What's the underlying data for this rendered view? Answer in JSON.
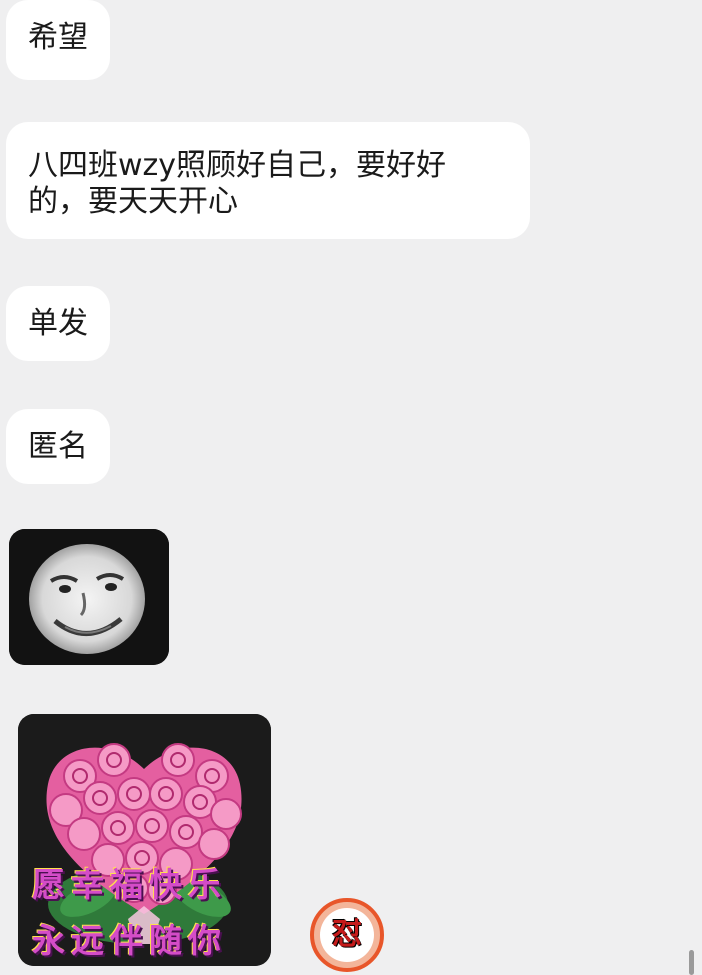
{
  "messages": [
    {
      "text": "希望"
    },
    {
      "text": "八四班wzy照顾好自己，要好好\n的，要天天开心"
    },
    {
      "text": "单发"
    },
    {
      "text": "匿名"
    }
  ],
  "stickers": {
    "face": {
      "icon": "meme-face-sticker"
    },
    "roses": {
      "icon": "pink-roses-bouquet",
      "caption_line1": "愿幸福快乐",
      "caption_line2": "永远伴随你"
    }
  },
  "reaction": {
    "label": "怼",
    "icon": "reaction-badge-icon"
  },
  "colors": {
    "background": "#efeff0",
    "bubble": "#ffffff",
    "text": "#1a1a1a",
    "rose": "#f07fb4",
    "badge_ring": "#e8562a"
  }
}
